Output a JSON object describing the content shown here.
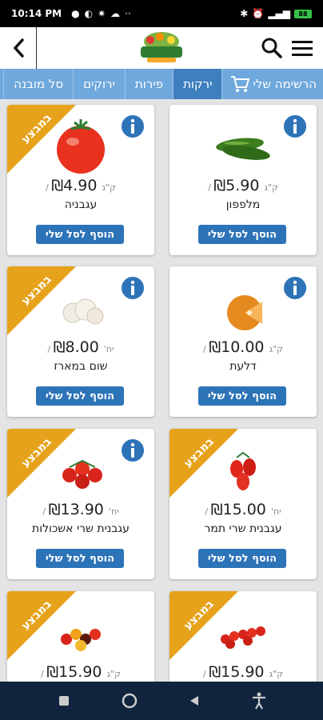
{
  "status": {
    "time": "10:14 PM",
    "battery": "88"
  },
  "tabs": [
    {
      "label": "הרשימה שלי",
      "id": "my-list"
    },
    {
      "label": "ירקות",
      "id": "vegetables",
      "active": true
    },
    {
      "label": "פירות",
      "id": "fruits"
    },
    {
      "label": "ירוקים",
      "id": "greens"
    },
    {
      "label": "סל מובנה",
      "id": "basket"
    }
  ],
  "labels": {
    "sale": "במבצע",
    "add": "הוסף לסל שלי",
    "currency": "₪"
  },
  "products": [
    {
      "name": "עגבניה",
      "price": "4.90",
      "unit": "/ ק\"ג",
      "sale": true,
      "info": true,
      "icon": "tomato"
    },
    {
      "name": "מלפפון",
      "price": "5.90",
      "unit": "/ ק\"ג",
      "sale": false,
      "info": true,
      "icon": "cucumbers"
    },
    {
      "name": "שום במארז",
      "price": "8.00",
      "unit": "/ יח'",
      "sale": true,
      "info": true,
      "icon": "garlic"
    },
    {
      "name": "דלעת",
      "price": "10.00",
      "unit": "/ ק\"ג",
      "sale": false,
      "info": true,
      "icon": "pumpkin"
    },
    {
      "name": "עגבנית שרי אשכולות",
      "price": "13.90",
      "unit": "/ יח'",
      "sale": true,
      "info": true,
      "icon": "cherry-tomatoes-vine"
    },
    {
      "name": "עגבנית שרי תמר",
      "price": "15.00",
      "unit": "/ יח'",
      "sale": true,
      "info": false,
      "icon": "date-tomatoes"
    },
    {
      "name": "",
      "price": "15.90",
      "unit": "/ ק\"ג",
      "sale": true,
      "info": false,
      "icon": "mixed-cherry-tomatoes"
    },
    {
      "name": "",
      "price": "15.90",
      "unit": "/ ק\"ג",
      "sale": true,
      "info": false,
      "icon": "cherry-tomato-branch"
    }
  ]
}
